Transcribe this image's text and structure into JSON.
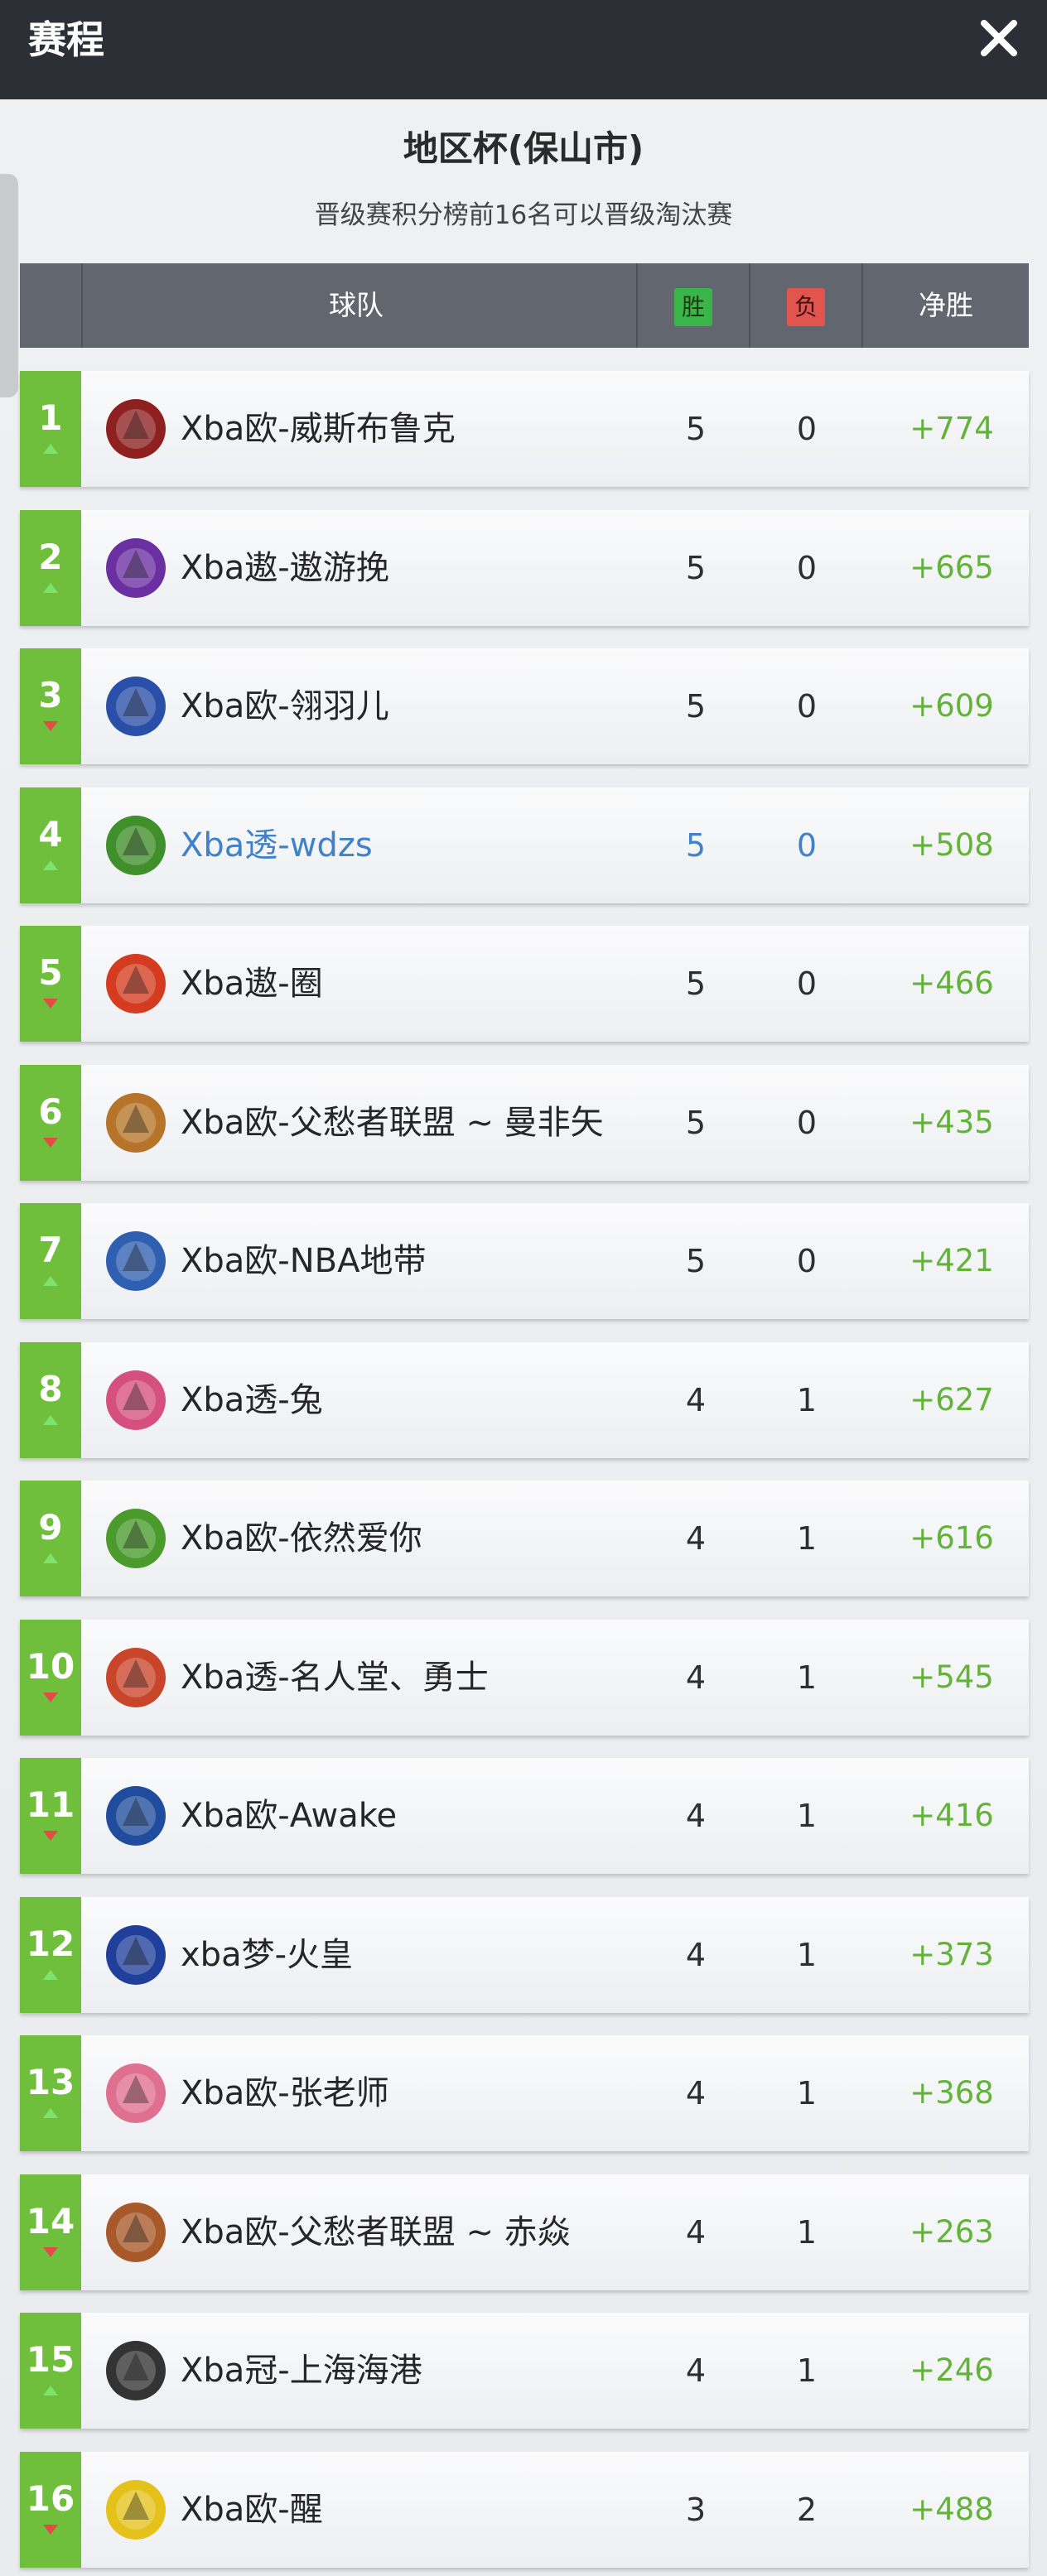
{
  "header": {
    "title": "赛程"
  },
  "section": {
    "title": "地区杯(保山市)",
    "subtitle": "晋级赛积分榜前16名可以晋级淘汰赛"
  },
  "table": {
    "columns": {
      "team": "球队",
      "wins": "胜",
      "losses": "负",
      "net": "净胜"
    },
    "rows": [
      {
        "rank": "1",
        "trend": "up",
        "name": "Xba欧-威斯布鲁克",
        "wins": "5",
        "losses": "0",
        "net": "+774",
        "logo_icon": "knight-helmet-logo-icon",
        "logo_color": "#8e2020"
      },
      {
        "rank": "2",
        "trend": "up",
        "name": "Xba遨-遨游挽",
        "wins": "5",
        "losses": "0",
        "net": "+665",
        "logo_icon": "purple-beast-logo-icon",
        "logo_color": "#6a2fa0"
      },
      {
        "rank": "3",
        "trend": "down",
        "name": "Xba欧-翎羽儿",
        "wins": "5",
        "losses": "0",
        "net": "+609",
        "logo_icon": "red-shield-logo-icon",
        "logo_color": "#2a4fa8"
      },
      {
        "rank": "4",
        "trend": "up",
        "name": "Xba透-wdzs",
        "wins": "5",
        "losses": "0",
        "net": "+508",
        "logo_icon": "green-dragon-logo-icon",
        "logo_color": "#3f8f2a",
        "highlight": true
      },
      {
        "rank": "5",
        "trend": "down",
        "name": "Xba遨-圈",
        "wins": "5",
        "losses": "0",
        "net": "+466",
        "logo_icon": "phoenix-logo-icon",
        "logo_color": "#d43b1f"
      },
      {
        "rank": "6",
        "trend": "down",
        "name": "Xba欧-父愁者联盟 ~ 曼非矢",
        "wins": "5",
        "losses": "0",
        "net": "+435",
        "logo_icon": "bulldog-logo-icon",
        "logo_color": "#b5742a"
      },
      {
        "rank": "7",
        "trend": "up",
        "name": "Xba欧-NBA地带",
        "wins": "5",
        "losses": "0",
        "net": "+421",
        "logo_icon": "basketball-logo-icon",
        "logo_color": "#2f5fb0"
      },
      {
        "rank": "8",
        "trend": "up",
        "name": "Xba透-兔",
        "wins": "4",
        "losses": "1",
        "net": "+627",
        "logo_icon": "pink-rabbit-logo-icon",
        "logo_color": "#d6507e"
      },
      {
        "rank": "9",
        "trend": "up",
        "name": "Xba欧-依然爱你",
        "wins": "4",
        "losses": "1",
        "net": "+616",
        "logo_icon": "green-crocodile-logo-icon",
        "logo_color": "#4a9a2c"
      },
      {
        "rank": "10",
        "trend": "down",
        "name": "Xba透-名人堂、勇士",
        "wins": "4",
        "losses": "1",
        "net": "+545",
        "logo_icon": "lion-logo-icon",
        "logo_color": "#c9452a"
      },
      {
        "rank": "11",
        "trend": "down",
        "name": "Xba欧-Awake",
        "wins": "4",
        "losses": "1",
        "net": "+416",
        "logo_icon": "spartan-logo-icon",
        "logo_color": "#1f4c9c"
      },
      {
        "rank": "12",
        "trend": "up",
        "name": "xba梦-火皇",
        "wins": "4",
        "losses": "1",
        "net": "+373",
        "logo_icon": "tiger-logo-icon",
        "logo_color": "#1f3f9a"
      },
      {
        "rank": "13",
        "trend": "up",
        "name": "Xba欧-张老师",
        "wins": "4",
        "losses": "1",
        "net": "+368",
        "logo_icon": "pig-logo-icon",
        "logo_color": "#e07090"
      },
      {
        "rank": "14",
        "trend": "down",
        "name": "Xba欧-父愁者联盟 ~ 赤焱",
        "wins": "4",
        "losses": "1",
        "net": "+263",
        "logo_icon": "bulldog-logo-icon",
        "logo_color": "#a7592a"
      },
      {
        "rank": "15",
        "trend": "up",
        "name": "Xba冠-上海海港",
        "wins": "4",
        "losses": "1",
        "net": "+246",
        "logo_icon": "ring-logo-icon",
        "logo_color": "#333333"
      },
      {
        "rank": "16",
        "trend": "down",
        "name": "Xba欧-醒",
        "wins": "3",
        "losses": "2",
        "net": "+488",
        "logo_icon": "yellow-bee-logo-icon",
        "logo_color": "#e4c21a"
      }
    ]
  },
  "colors": {
    "rank_bg": "#6fbf3c",
    "net_text": "#63b33a",
    "highlight_text": "#3f82c8",
    "trend_up": "#7de36a",
    "trend_down": "#e24c45"
  }
}
